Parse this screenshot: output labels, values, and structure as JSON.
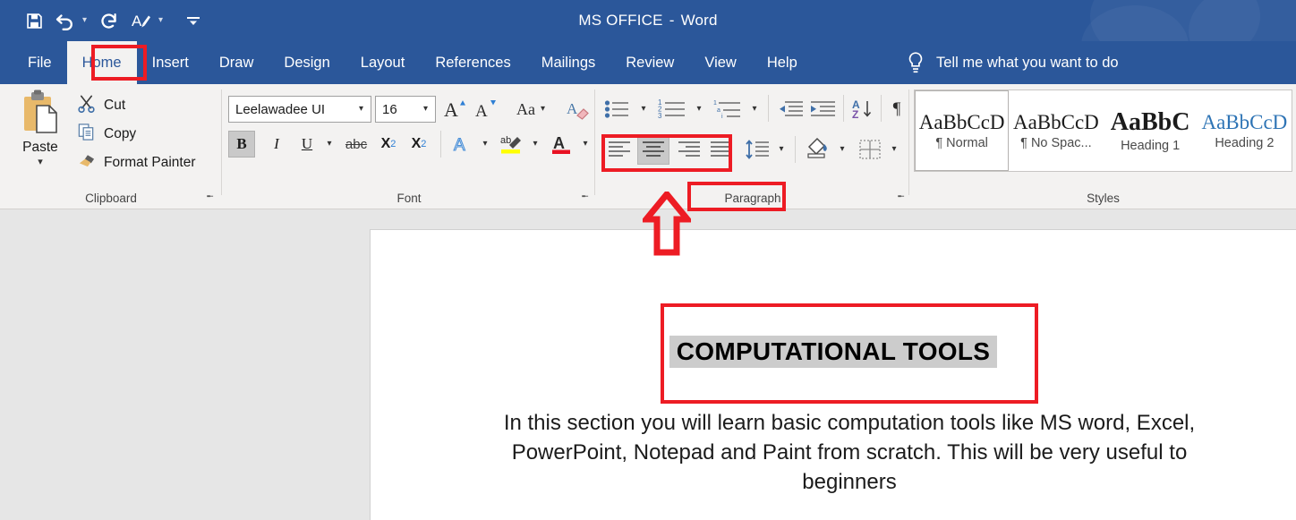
{
  "window": {
    "title_main": "MS OFFICE",
    "title_sep": "-",
    "title_app": "Word",
    "accent_color": "#2b579a",
    "annotation_color": "#ed1c24"
  },
  "quick_access": [
    {
      "name": "save-icon",
      "label": "Save",
      "caret": false
    },
    {
      "name": "undo-icon",
      "label": "Undo",
      "caret": true
    },
    {
      "name": "redo-icon",
      "label": "Redo",
      "caret": false
    },
    {
      "name": "repeat-style-icon",
      "label": "Repeat Styling",
      "caret": true
    },
    {
      "name": "customize-qat-icon",
      "label": "Customize Quick Access Toolbar",
      "caret": false
    }
  ],
  "tabs": [
    {
      "label": "File",
      "active": false
    },
    {
      "label": "Home",
      "active": true
    },
    {
      "label": "Insert",
      "active": false
    },
    {
      "label": "Draw",
      "active": false
    },
    {
      "label": "Design",
      "active": false
    },
    {
      "label": "Layout",
      "active": false
    },
    {
      "label": "References",
      "active": false
    },
    {
      "label": "Mailings",
      "active": false
    },
    {
      "label": "Review",
      "active": false
    },
    {
      "label": "View",
      "active": false
    },
    {
      "label": "Help",
      "active": false
    }
  ],
  "tell_me": {
    "label": "Tell me what you want to do",
    "icon": "lightbulb-icon"
  },
  "ribbon": {
    "clipboard": {
      "group_label": "Clipboard",
      "paste_label": "Paste",
      "items": [
        {
          "label": "Cut",
          "icon": "scissors-icon"
        },
        {
          "label": "Copy",
          "icon": "copy-icon"
        },
        {
          "label": "Format Painter",
          "icon": "paintbrush-icon"
        }
      ]
    },
    "font": {
      "group_label": "Font",
      "font_family_value": "Leelawadee UI",
      "font_size_value": "16",
      "buttons": [
        {
          "name": "grow-font-button",
          "label": "A"
        },
        {
          "name": "shrink-font-button",
          "label": "A"
        },
        {
          "name": "change-case-button",
          "label": "Aa"
        },
        {
          "name": "clear-formatting-button",
          "label": "A"
        },
        {
          "name": "bold-button",
          "label": "B",
          "active": true
        },
        {
          "name": "italic-button",
          "label": "I"
        },
        {
          "name": "underline-button",
          "label": "U"
        },
        {
          "name": "strikethrough-button",
          "label": "abc"
        },
        {
          "name": "subscript-button",
          "label": "X2"
        },
        {
          "name": "superscript-button",
          "label": "X2"
        },
        {
          "name": "text-effects-button",
          "label": "A"
        },
        {
          "name": "text-highlight-button",
          "label": "ab"
        },
        {
          "name": "font-color-button",
          "label": "A"
        }
      ]
    },
    "paragraph": {
      "group_label": "Paragraph",
      "buttons": [
        {
          "name": "bullets-button",
          "label": "Bullets"
        },
        {
          "name": "numbering-button",
          "label": "Numbering"
        },
        {
          "name": "multilevel-list-button",
          "label": "Multilevel List"
        },
        {
          "name": "decrease-indent-button",
          "label": "Decrease Indent"
        },
        {
          "name": "increase-indent-button",
          "label": "Increase Indent"
        },
        {
          "name": "sort-button",
          "label": "Sort"
        },
        {
          "name": "show-formatting-button",
          "label": "Show/Hide"
        },
        {
          "name": "align-left-button",
          "label": "Align Left",
          "active": false
        },
        {
          "name": "align-center-button",
          "label": "Center",
          "active": true
        },
        {
          "name": "align-right-button",
          "label": "Align Right",
          "active": false
        },
        {
          "name": "justify-button",
          "label": "Justify",
          "active": false
        },
        {
          "name": "line-spacing-button",
          "label": "Line and Paragraph Spacing"
        },
        {
          "name": "shading-button",
          "label": "Shading"
        },
        {
          "name": "borders-button",
          "label": "Borders"
        }
      ]
    },
    "styles": {
      "group_label": "Styles",
      "gallery": [
        {
          "preview": "AaBbCcD",
          "name": "¶ Normal",
          "selected": true,
          "style": "normal"
        },
        {
          "preview": "AaBbCcD",
          "name": "¶ No Spac...",
          "selected": false,
          "style": "nospacing"
        },
        {
          "preview": "AaBbC",
          "name": "Heading 1",
          "selected": false,
          "style": "heading1"
        },
        {
          "preview": "AaBbCcD",
          "name": "Heading 2",
          "selected": false,
          "style": "heading2"
        }
      ]
    }
  },
  "document": {
    "title": "COMPUTATIONAL TOOLS",
    "title_highlight_color": "#cccccc",
    "body": "In this section you will learn basic computation tools like MS word, Excel, PowerPoint, Notepad and Paint from scratch. This will be very useful to beginners"
  },
  "annotations": [
    {
      "name": "home-tab-highlight",
      "target": "Home tab"
    },
    {
      "name": "alignment-group-highlight",
      "target": "Paragraph alignment buttons"
    },
    {
      "name": "paragraph-label-highlight",
      "target": "Paragraph group label"
    },
    {
      "name": "title-highlight",
      "target": "Document title"
    },
    {
      "name": "up-arrow-pointer",
      "target": "Paragraph alignment buttons"
    }
  ]
}
